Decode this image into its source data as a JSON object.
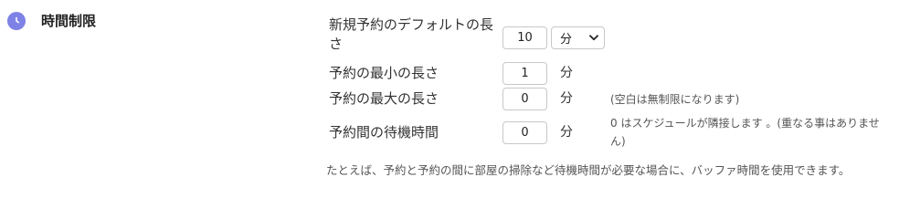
{
  "section": {
    "icon": "clock-icon",
    "title": "時間制限",
    "accent_color": "#7e82e6"
  },
  "rows": {
    "default_length": {
      "label": "新規予約のデフォルトの長さ",
      "value": "10",
      "unit_selected": "分"
    },
    "min_length": {
      "label": "予約の最小の長さ",
      "value": "1",
      "unit": "分"
    },
    "max_length": {
      "label": "予約の最大の長さ",
      "value": "0",
      "unit": "分",
      "note": "(空白は無制限になります)"
    },
    "buffer": {
      "label": "予約間の待機時間",
      "value": "0",
      "unit": "分",
      "note": "0 はスケジュールが隣接します 。(重なる事はありません)"
    }
  },
  "footer_note": "たとえば、予約と予約の間に部屋の掃除など待機時間が必要な場合に、バッファ時間を使用できます。"
}
